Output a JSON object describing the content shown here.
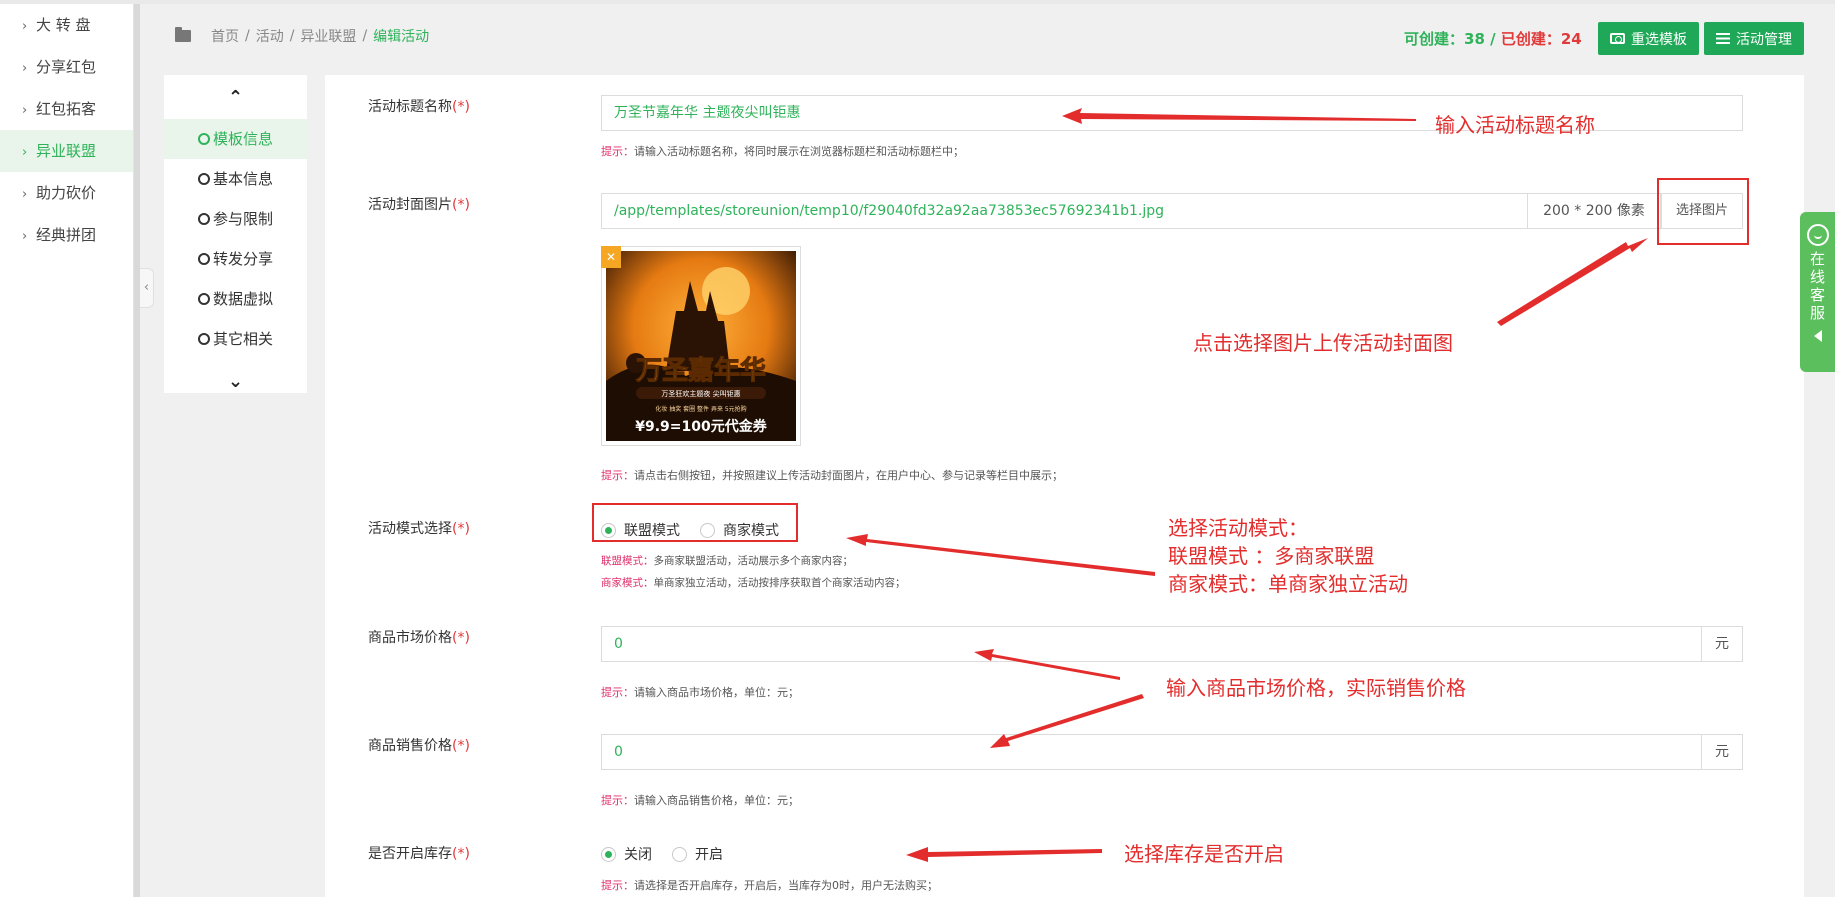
{
  "sidebar": {
    "items": [
      {
        "label": "大 转 盘",
        "active": false
      },
      {
        "label": "分享红包",
        "active": false
      },
      {
        "label": "红包拓客",
        "active": false
      },
      {
        "label": "异业联盟",
        "active": true
      },
      {
        "label": "助力砍价",
        "active": false
      },
      {
        "label": "经典拼团",
        "active": false
      }
    ],
    "collapse_glyph": "‹"
  },
  "breadcrumb": {
    "home": "首页",
    "sep": "/",
    "activity": "活动",
    "union": "异业联盟",
    "current": "编辑活动"
  },
  "header": {
    "can_create_label": "可创建：",
    "can_create_value": "38",
    "sep": "/",
    "created_label": "已创建：",
    "created_value": "24",
    "reselect_button": "重选模板",
    "manage_button": "活动管理"
  },
  "steps": {
    "up_glyph": "⌃",
    "down_glyph": "⌄",
    "items": [
      {
        "label": "模板信息",
        "active": true
      },
      {
        "label": "基本信息",
        "active": false
      },
      {
        "label": "参与限制",
        "active": false
      },
      {
        "label": "转发分享",
        "active": false
      },
      {
        "label": "数据虚拟",
        "active": false
      },
      {
        "label": "其它相关",
        "active": false
      }
    ]
  },
  "form": {
    "title": {
      "label": "活动标题名称",
      "req": "(*)",
      "value": "万圣节嘉年华 主题夜尖叫钜惠",
      "hint_prefix": "提示：",
      "hint": "请输入活动标题名称，将同时展示在浏览器标题栏和活动标题栏中；"
    },
    "cover": {
      "label": "活动封面图片",
      "req": "(*)",
      "value": "/app/templates/storeunion/temp10/f29040fd32a92aa73853ec57692341b1.jpg",
      "size": "200 * 200 像素",
      "button": "选择图片",
      "delete_glyph": "✕",
      "hint_prefix": "提示：",
      "hint": "请点击右侧按钮，并按照建议上传活动封面图片，在用户中心、参与记录等栏目中展示；",
      "image_text": {
        "big": "万圣嘉年华",
        "sub": "万圣狂欢主题夜 尖叫钜惠",
        "small": "化妆 抽奖 套圈 整件 弄来 5元抢购",
        "price": "¥9.9=100元代金券"
      }
    },
    "mode": {
      "label": "活动模式选择",
      "req": "(*)",
      "options": [
        "联盟模式",
        "商家模式"
      ],
      "selected": 0,
      "note1_prefix": "联盟模式：",
      "note1": "多商家联盟活动，活动展示多个商家内容；",
      "note2_prefix": "商家模式：",
      "note2": "单商家独立活动，活动按排序获取首个商家活动内容；"
    },
    "market_price": {
      "label": "商品市场价格",
      "req": "(*)",
      "value": "0",
      "unit": "元",
      "hint_prefix": "提示：",
      "hint": "请输入商品市场价格，单位：元；"
    },
    "sale_price": {
      "label": "商品销售价格",
      "req": "(*)",
      "value": "0",
      "unit": "元",
      "hint_prefix": "提示：",
      "hint": "请输入商品销售价格，单位：元；"
    },
    "stock": {
      "label": "是否开启库存",
      "req": "(*)",
      "options": [
        "关闭",
        "开启"
      ],
      "selected": 0,
      "hint_prefix": "提示：",
      "hint": "请选择是否开启库存，开启后，当库存为0时，用户无法购买；"
    }
  },
  "annotations": {
    "title": "输入活动标题名称",
    "cover": "点击选择图片上传活动封面图",
    "mode_1": "选择活动模式：",
    "mode_2": "联盟模式 ：多商家联盟",
    "mode_3": "商家模式：单商家独立活动",
    "price": "输入商品市场价格，实际销售价格",
    "stock": "选择库存是否开启"
  },
  "service_tab": {
    "label": "在线客服"
  },
  "colors": {
    "brand_green": "#1fa857",
    "accent_green": "#2fb35a",
    "annotation_red": "#e32d2d",
    "hint_pink": "#e0306a"
  }
}
